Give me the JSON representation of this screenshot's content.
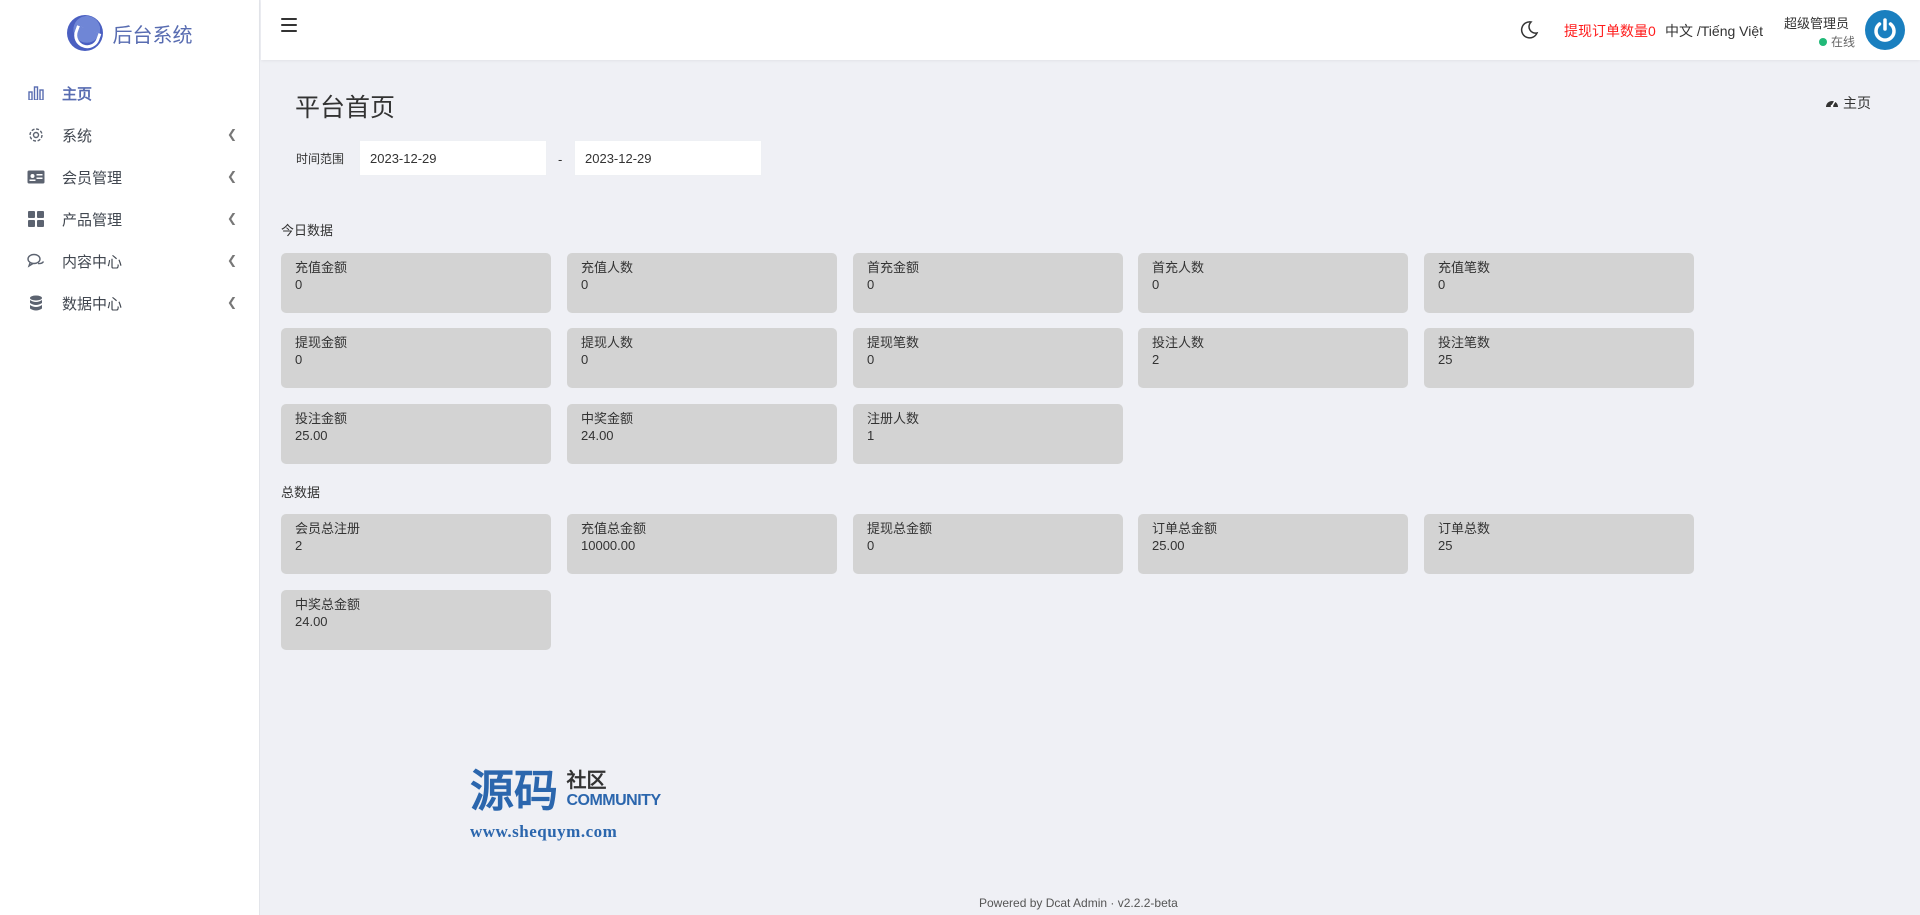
{
  "brand": {
    "name": "后台系统"
  },
  "sidebar": {
    "items": [
      {
        "label": "主页",
        "icon": "bar-chart-icon"
      },
      {
        "label": "系统",
        "icon": "gear-icon"
      },
      {
        "label": "会员管理",
        "icon": "id-card-icon"
      },
      {
        "label": "产品管理",
        "icon": "grid-icon"
      },
      {
        "label": "内容中心",
        "icon": "comments-icon"
      },
      {
        "label": "数据中心",
        "icon": "database-icon"
      }
    ]
  },
  "header": {
    "withdraw_note": "提现订单数量0",
    "language": "中文 /Tiếng Việt",
    "user_name": "超级管理员",
    "user_status": "在线"
  },
  "page": {
    "title": "平台首页",
    "breadcrumb": "主页",
    "range_label": "时间范围",
    "date_start": "2023-12-29",
    "date_separator": "-",
    "date_end": "2023-12-29"
  },
  "today": {
    "title": "今日数据",
    "cards": [
      {
        "label": "充值金额",
        "value": "0"
      },
      {
        "label": "充值人数",
        "value": "0"
      },
      {
        "label": "首充金额",
        "value": "0"
      },
      {
        "label": "首充人数",
        "value": "0"
      },
      {
        "label": "充值笔数",
        "value": "0"
      },
      {
        "label": "提现金额",
        "value": "0"
      },
      {
        "label": "提现人数",
        "value": "0"
      },
      {
        "label": "提现笔数",
        "value": "0"
      },
      {
        "label": "投注人数",
        "value": "2"
      },
      {
        "label": "投注笔数",
        "value": "25"
      },
      {
        "label": "投注金额",
        "value": "25.00"
      },
      {
        "label": "中奖金额",
        "value": "24.00"
      },
      {
        "label": "注册人数",
        "value": "1"
      }
    ]
  },
  "total": {
    "title": "总数据",
    "cards": [
      {
        "label": "会员总注册",
        "value": "2"
      },
      {
        "label": "充值总金额",
        "value": "10000.00"
      },
      {
        "label": "提现总金额",
        "value": "0"
      },
      {
        "label": "订单总金额",
        "value": "25.00"
      },
      {
        "label": "订单总数",
        "value": "25"
      },
      {
        "label": "中奖总金额",
        "value": "24.00"
      }
    ]
  },
  "watermark": {
    "big": "源码",
    "cn": "社区",
    "en": "COMMUNITY",
    "url": "www.shequym.com"
  },
  "footer": {
    "text": "Powered by Dcat Admin · v2.2.2-beta"
  },
  "colors": {
    "accent": "#586cb1",
    "card": "#d3d3d3",
    "alert": "#ff1b1b",
    "online": "#21b978"
  }
}
